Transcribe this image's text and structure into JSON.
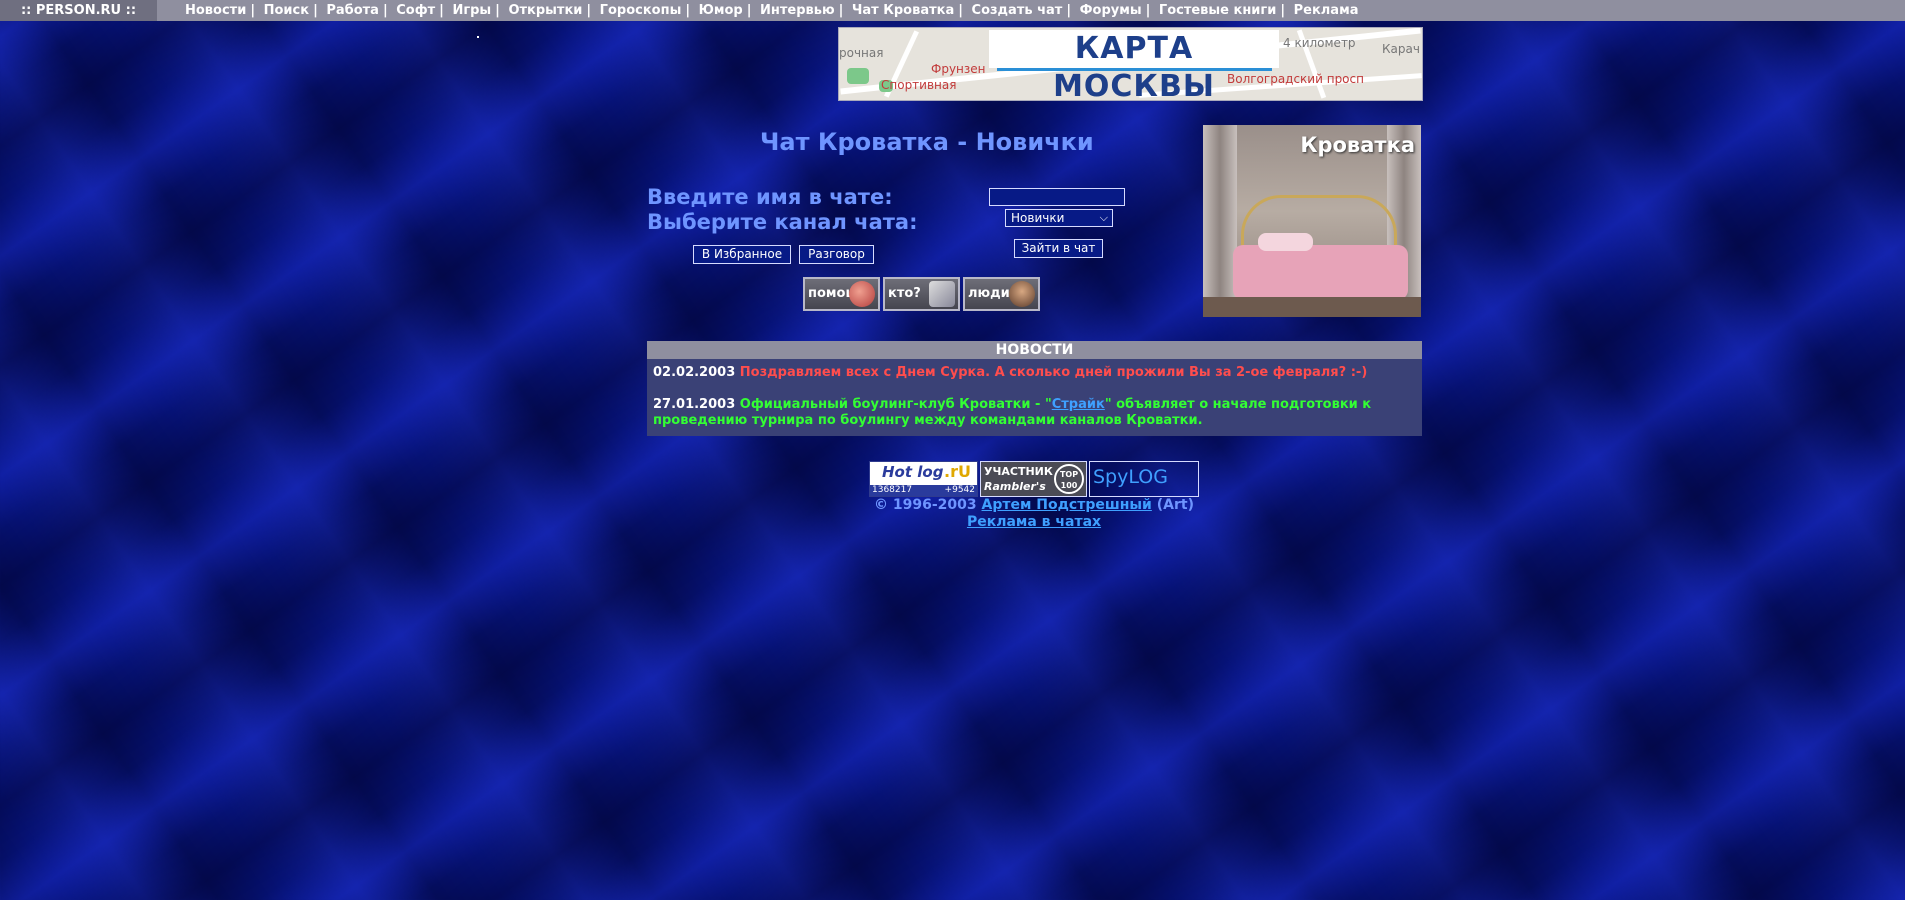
{
  "header": {
    "site": ":: PERSON.RU ::",
    "nav": [
      {
        "label": "Новости"
      },
      {
        "label": "Поиск"
      },
      {
        "label": "Работа"
      },
      {
        "label": "Софт"
      },
      {
        "label": "Игры"
      },
      {
        "label": "Открытки"
      },
      {
        "label": "Гороскопы"
      },
      {
        "label": "Юмор"
      },
      {
        "label": "Интервью"
      },
      {
        "label": "Чат Кроватка"
      },
      {
        "label": "Создать чат"
      },
      {
        "label": "Форумы"
      },
      {
        "label": "Гостевые книги"
      },
      {
        "label": "Реклама"
      }
    ],
    "separator": "|"
  },
  "banner": {
    "title": "КАРТА МОСКВЫ",
    "streets": [
      "рочная",
      "Фрунзен",
      "Спортивная",
      "4 километр",
      "Карач",
      "Волгоградский просп"
    ]
  },
  "chat": {
    "title": "Чат Кроватка - Новички",
    "name_label": "Введите имя в чате:",
    "name_value": "",
    "channel_label": "Выберите канал чата:",
    "channel_selected": "Новички",
    "enter_label": "Зайти в чат",
    "favorites_label": "В Избранное",
    "talk_label": "Разговор",
    "help_label": "помощь",
    "who_label": "кто?",
    "people_label": "люди",
    "photo_caption": "Кроватка"
  },
  "news": {
    "header": "НОВОСТИ",
    "items": [
      {
        "date": "02.02.2003",
        "text": "Поздравляем всех с Днем Сурка. А сколько дней прожили Вы за 2-ое февраля? :-)"
      },
      {
        "date": "27.01.2003",
        "text_before": "Официальный боулинг-клуб Кроватки - \"",
        "link": "Страйк",
        "text_after": "\" объявляет о начале подготовки к проведению турнира по боулингу между командами каналов Кроватки."
      }
    ]
  },
  "counters": {
    "hotlog": {
      "logo": "Hot log",
      "ru": ".rU",
      "hits": "1368217",
      "delta": "+9542"
    },
    "rambler": {
      "line1": "УЧАСТНИК",
      "line2": "Rambler's",
      "badge": "TOP 100"
    },
    "spylog": {
      "alt": "SpyLOG"
    }
  },
  "footer": {
    "copyright_prefix": "© 1996-2003 ",
    "author_link": "Артем Подстрешный",
    "copyright_suffix": " (Art)",
    "ads_link": "Реклама в чатах"
  },
  "colors": {
    "background": "#061276",
    "accent_text": "#6f95ff",
    "news_red": "#ff4d4d",
    "news_green": "#33ff33",
    "link": "#3fa0ff"
  }
}
